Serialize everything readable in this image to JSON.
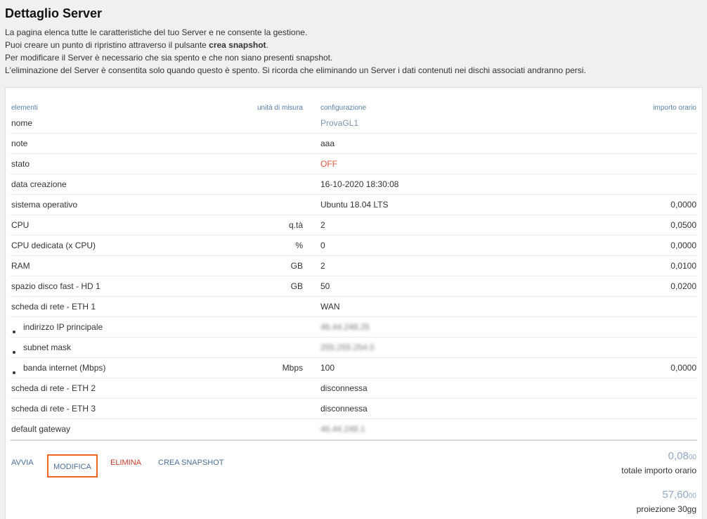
{
  "page": {
    "title": "Dettaglio Server",
    "intro": [
      {
        "text": "La pagina elenca tutte le caratteristiche del tuo Server e ne consente la gestione.",
        "bold": ""
      },
      {
        "text": "Puoi creare un punto di ripristino attraverso il pulsante ",
        "bold": "crea snapshot",
        "after": "."
      },
      {
        "text": "Per modificare il Server è necessario che sia spento e che non siano presenti snapshot.",
        "bold": ""
      },
      {
        "text": "L'eliminazione del Server è consentita solo quando questo è spento. Si ricorda che eliminando un Server i dati contenuti nei dischi associati andranno persi.",
        "bold": ""
      }
    ]
  },
  "table": {
    "headers": {
      "elementi": "elementi",
      "unita": "unità di misura",
      "configurazione": "configurazione",
      "importo": "importo orario"
    },
    "rows": [
      {
        "el": "nome",
        "unit": "",
        "conf": "ProvaGL1",
        "price": "",
        "style": "link"
      },
      {
        "el": "note",
        "unit": "",
        "conf": "aaa",
        "price": ""
      },
      {
        "el": "stato",
        "unit": "",
        "conf": "OFF",
        "price": "",
        "style": "off"
      },
      {
        "el": "data creazione",
        "unit": "",
        "conf": "16-10-2020 18:30:08",
        "price": ""
      },
      {
        "el": "sistema operativo",
        "unit": "",
        "conf": "Ubuntu 18.04 LTS",
        "price": "0,0000"
      },
      {
        "el": "CPU",
        "unit": "q.tà",
        "conf": "2",
        "price": "0,0500"
      },
      {
        "el": "CPU dedicata (x CPU)",
        "unit": "%",
        "conf": "0",
        "price": "0,0000"
      },
      {
        "el": "RAM",
        "unit": "GB",
        "conf": "2",
        "price": "0,0100"
      },
      {
        "el": "spazio disco fast - HD 1",
        "unit": "GB",
        "conf": "50",
        "price": "0,0200"
      },
      {
        "el": "scheda di rete - ETH 1",
        "unit": "",
        "conf": "WAN",
        "price": ""
      },
      {
        "el": "indirizzo IP principale",
        "unit": "",
        "conf": "46.44.248.25",
        "price": "",
        "bullet": true,
        "style": "blur"
      },
      {
        "el": "subnet mask",
        "unit": "",
        "conf": "255.255.254.0",
        "price": "",
        "bullet": true,
        "style": "blur"
      },
      {
        "el": "banda internet (Mbps)",
        "unit": "Mbps",
        "conf": "100",
        "price": "0,0000",
        "bullet": true
      },
      {
        "el": "scheda di rete - ETH 2",
        "unit": "",
        "conf": "disconnessa",
        "price": ""
      },
      {
        "el": "scheda di rete - ETH 3",
        "unit": "",
        "conf": "disconnessa",
        "price": ""
      },
      {
        "el": "default gateway",
        "unit": "",
        "conf": "46.44.248.1",
        "price": "",
        "style": "blur"
      }
    ]
  },
  "actions": {
    "avvia": "AVVIA",
    "modifica": "MODIFICA",
    "elimina": "ELIMINA",
    "snapshot": "CREA SNAPSHOT"
  },
  "totals": {
    "hourly_int": "0,08",
    "hourly_dec": "00",
    "hourly_label": "totale importo orario",
    "projection_int": "57,60",
    "projection_dec": "00",
    "projection_label": "proiezione 30gg"
  },
  "colors": {
    "accent": "#4a6f95",
    "danger": "#c0392b",
    "off": "#e0563c",
    "highlight": "#f06524"
  }
}
